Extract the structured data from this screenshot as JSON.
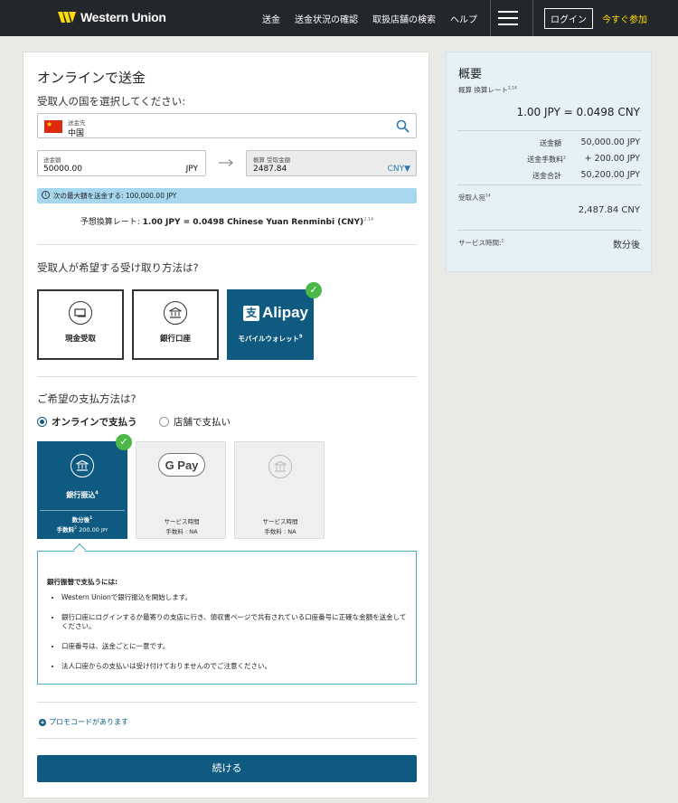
{
  "header": {
    "brand": "Western Union",
    "nav": [
      "送金",
      "送金状況の確認",
      "取扱店舗の検索",
      "ヘルプ"
    ],
    "login": "ログイン",
    "signup": "今すぐ参加",
    "colors": {
      "bar": "#23262b",
      "logo_yellow": "#ffdd00"
    }
  },
  "form": {
    "title": "オンラインで送金",
    "country_prompt": "受取人の国を選択してください:",
    "destination_label": "送金先",
    "destination_value": "中国",
    "send_amount_label": "送金額",
    "send_amount_value": "50000.00",
    "send_currency": "JPY",
    "receive_label": "概算 受取金額",
    "receive_value": "2487.84",
    "receive_currency": "CNY▼",
    "max_notice": "次の最大額を送金する: 100,000.00 JPY",
    "rate_prefix": "予想換算レート: ",
    "rate_value": "1.00 JPY = 0.0498 Chinese Yuan Renminbi (CNY)",
    "rate_sup": "2,14",
    "receive_method_prompt": "受取人が希望する受け取り方法は?",
    "receive_methods": [
      {
        "label": "現金受取",
        "icon": "cash-icon"
      },
      {
        "label": "銀行口座",
        "icon": "bank-icon"
      },
      {
        "label": "モバイルウォレット",
        "sup": "9",
        "brand": "Alipay",
        "selected": true
      }
    ],
    "pay_method_prompt": "ご希望の支払方法は?",
    "pay_options": [
      "オンラインで支払う",
      "店舗で支払い"
    ],
    "pay_cards": [
      {
        "label": "銀行振込",
        "sup": "4",
        "time_label": "数分後",
        "time_sup": "1",
        "fee_label": "手数料",
        "fee_sup": "2",
        "fee_value": "200.00",
        "fee_currency": "JPY",
        "selected": true
      },
      {
        "brand": "G Pay",
        "time_label": "サービス時間",
        "fee_line": "手数料 : NA"
      },
      {
        "time_label": "サービス時間",
        "fee_line": "手数料 : NA"
      }
    ],
    "instructions": {
      "title": "銀行振替で支払うには:",
      "items": [
        "Western Unionで銀行振込を開始します。",
        "銀行口座にログインするか最寄りの支店に行き、領収書ページで共有されている口座番号に正確な金額を送金してください。",
        "口座番号は、送金ごとに一意です。",
        "法人口座からの支払いは受け付けておりませんのでご注意ください。"
      ]
    },
    "promo": "プロモコードがあります",
    "continue": "続ける",
    "colors": {
      "primary": "#0f5a80",
      "check": "#4cb847",
      "info": "#a6d7ef"
    }
  },
  "summary": {
    "title": "概要",
    "rate_label": "概算 換算レート",
    "rate_sup": "2,14",
    "rate_value": "1.00 JPY = 0.0498 CNY",
    "rows": [
      {
        "label": "送金額",
        "sup": "",
        "value": "50,000.00 JPY"
      },
      {
        "label": "送金手数料",
        "sup": "2",
        "value": "+ 200.00 JPY"
      },
      {
        "label": "送金合計",
        "sup": "",
        "value": "50,200.00 JPY"
      }
    ],
    "recipient_label": "受取人宛",
    "recipient_sup": "14",
    "recipient_value": "2,487.84 CNY",
    "service_label": "サービス時間:",
    "service_sup": "1",
    "service_value": "数分後"
  }
}
